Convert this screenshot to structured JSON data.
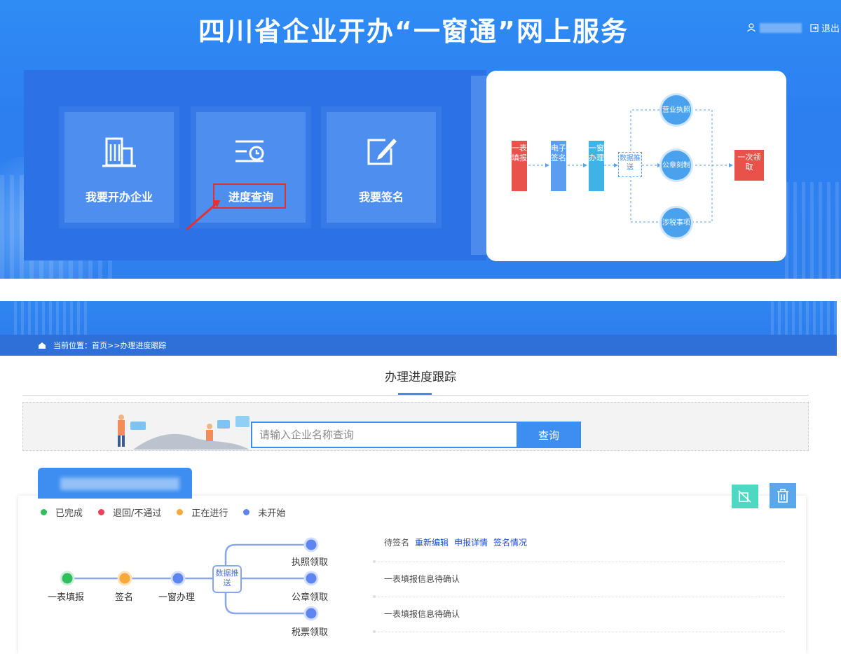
{
  "header": {
    "site_title": "四川省企业开办“一窗通”网上服务",
    "logout_label": "退出"
  },
  "banner_tiles": [
    {
      "label": "我要开办企业",
      "icon": "building-icon"
    },
    {
      "label": "进度查询",
      "icon": "progress-query-icon"
    },
    {
      "label": "我要签名",
      "icon": "sign-edit-icon"
    }
  ],
  "flow_diagram": {
    "steps": [
      "一表填报",
      "电子签名",
      "一窗办理",
      "数据推送"
    ],
    "branches": [
      "营业执照",
      "公章刻制",
      "涉税事项"
    ],
    "final": "一次领取"
  },
  "breadcrumb": {
    "text": "当前位置：首页>>办理进度跟踪"
  },
  "page_title": "办理进度跟踪",
  "search": {
    "placeholder": "请输入企业名称查询",
    "button_label": "查询"
  },
  "legend": [
    {
      "label": "已完成",
      "color": "#2fbf5e"
    },
    {
      "label": "退回/不通过",
      "color": "#f0405a"
    },
    {
      "label": "正在进行",
      "color": "#f7a93b"
    },
    {
      "label": "未开始",
      "color": "#5d86f0"
    }
  ],
  "process": {
    "stages": [
      "一表填报",
      "签名",
      "一窗办理"
    ],
    "push_node": "数据推送",
    "outputs": [
      "执照领取",
      "公章领取",
      "税票领取"
    ]
  },
  "record": {
    "status_text": "待签名",
    "links": [
      "重新编辑",
      "申报详情",
      "签名情况"
    ],
    "details": [
      "一表填报信息待确认",
      "一表填报信息待确认"
    ]
  },
  "colors": {
    "primary": "#3d8ef0",
    "banner": "#2e80ef",
    "highlight": "#e5312e"
  }
}
